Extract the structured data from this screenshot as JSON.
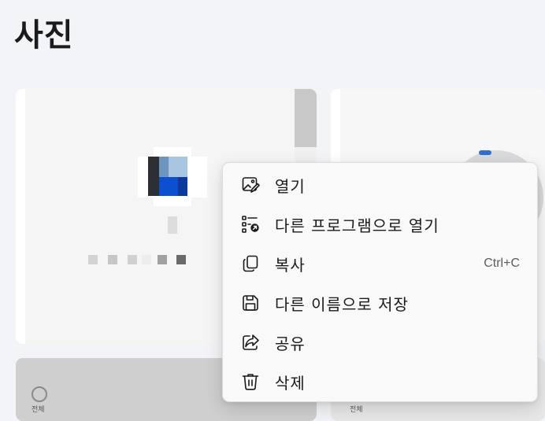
{
  "page": {
    "title": "사진"
  },
  "gallery": {
    "item_label": "전체"
  },
  "context_menu": {
    "items": [
      {
        "id": "open",
        "label": "열기",
        "icon": "image-edit-icon",
        "shortcut": ""
      },
      {
        "id": "open-with",
        "label": "다른 프로그램으로 열기",
        "icon": "open-with-icon",
        "shortcut": ""
      },
      {
        "id": "copy",
        "label": "복사",
        "icon": "copy-icon",
        "shortcut": "Ctrl+C"
      },
      {
        "id": "save-as",
        "label": "다른 이름으로 저장",
        "icon": "save-icon",
        "shortcut": ""
      },
      {
        "id": "share",
        "label": "공유",
        "icon": "share-icon",
        "shortcut": ""
      },
      {
        "id": "delete",
        "label": "삭제",
        "icon": "trash-icon",
        "shortcut": ""
      }
    ]
  },
  "colors": {
    "accent": "#2f6fd6",
    "menu_bg": "#f9f9f9",
    "page_bg": "#f3f4f8"
  }
}
